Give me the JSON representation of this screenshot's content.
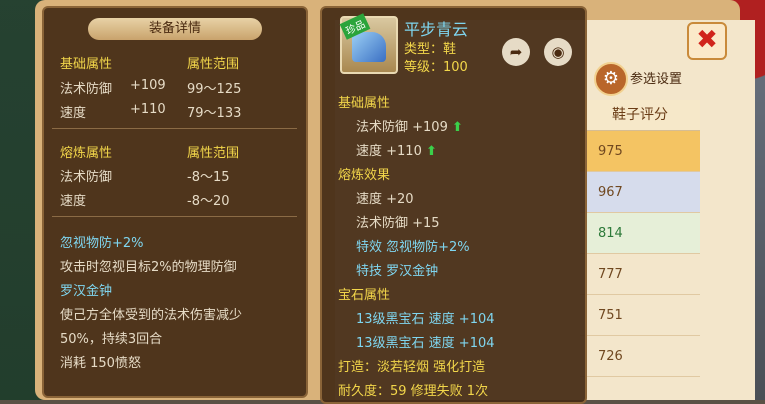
{
  "background": {
    "ranking_header": "鞋子评分",
    "scores": [
      "975",
      "967",
      "814",
      "777",
      "751",
      "726"
    ],
    "settings_label": "参选设置",
    "close_icon": "✖"
  },
  "left_panel": {
    "title": "装备详情",
    "basic_header": "基础属性",
    "range_header": "属性范围",
    "basic_rows": [
      {
        "name": "法术防御",
        "value": "+109",
        "range": "99～125"
      },
      {
        "name": "速度",
        "value": "+110",
        "range": "79～133"
      }
    ],
    "refine_header": "熔炼属性",
    "refine_range_header": "属性范围",
    "refine_rows": [
      {
        "name": "法术防御",
        "range": "-8～15"
      },
      {
        "name": "速度",
        "range": "-8～20"
      }
    ],
    "effect_name": "忽视物防+2%",
    "effect_desc": "攻击时忽视目标2%的物理防御",
    "skill_name": "罗汉金钟",
    "skill_desc1": "使己方全体受到的法术伤害减少",
    "skill_desc2": "50%，持续3回合",
    "skill_cost": "消耗 150愤怒"
  },
  "right_panel": {
    "item_name": "平步青云",
    "tag": "珍品",
    "type": "类型：鞋",
    "level": "等级：100",
    "basic_header": "基础属性",
    "basic_rows": [
      {
        "text": "法术防御  +109"
      },
      {
        "text": "速度  +110"
      }
    ],
    "refine_header": "熔炼效果",
    "refine_rows": [
      "速度  +20",
      "法术防御  +15"
    ],
    "special_effect": "特效  忽视物防+2%",
    "special_skill": "特技  罗汉金钟",
    "gem_header": "宝石属性",
    "gem_rows": [
      "13级黑宝石  速度  +104",
      "13级黑宝石  速度  +104"
    ],
    "forge": "打造：淡若轻烟  强化打造",
    "durability": "耐久度：59  修理失败 1次"
  }
}
